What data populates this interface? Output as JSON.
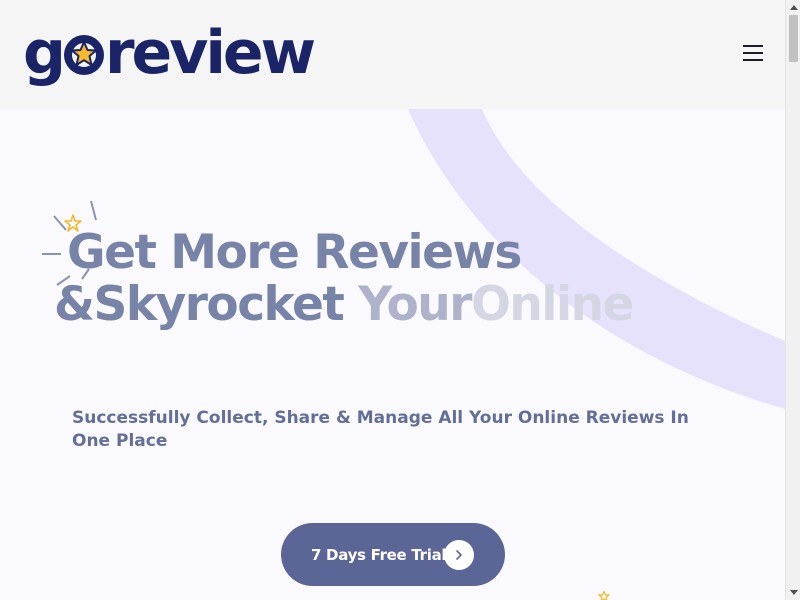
{
  "header": {
    "logo_prefix": "g",
    "logo_suffix": "review",
    "menu_icon": "hamburger-icon"
  },
  "hero": {
    "headline_line1": "Get More Reviews",
    "headline_line2_a": "&Skyrocket",
    "headline_line2_b": "Your",
    "headline_line2_c": "Online",
    "subtitle": "Successfully Collect, Share & Manage All Your Online Reviews In One Place",
    "cta_label": "7 Days Free Trial",
    "cta_icon": "chevron-right-icon"
  },
  "colors": {
    "brand_navy": "#1b2467",
    "star_yellow": "#f7b82a",
    "cta_bg": "#5c6696",
    "arc_lavender": "#e6e2fc"
  }
}
